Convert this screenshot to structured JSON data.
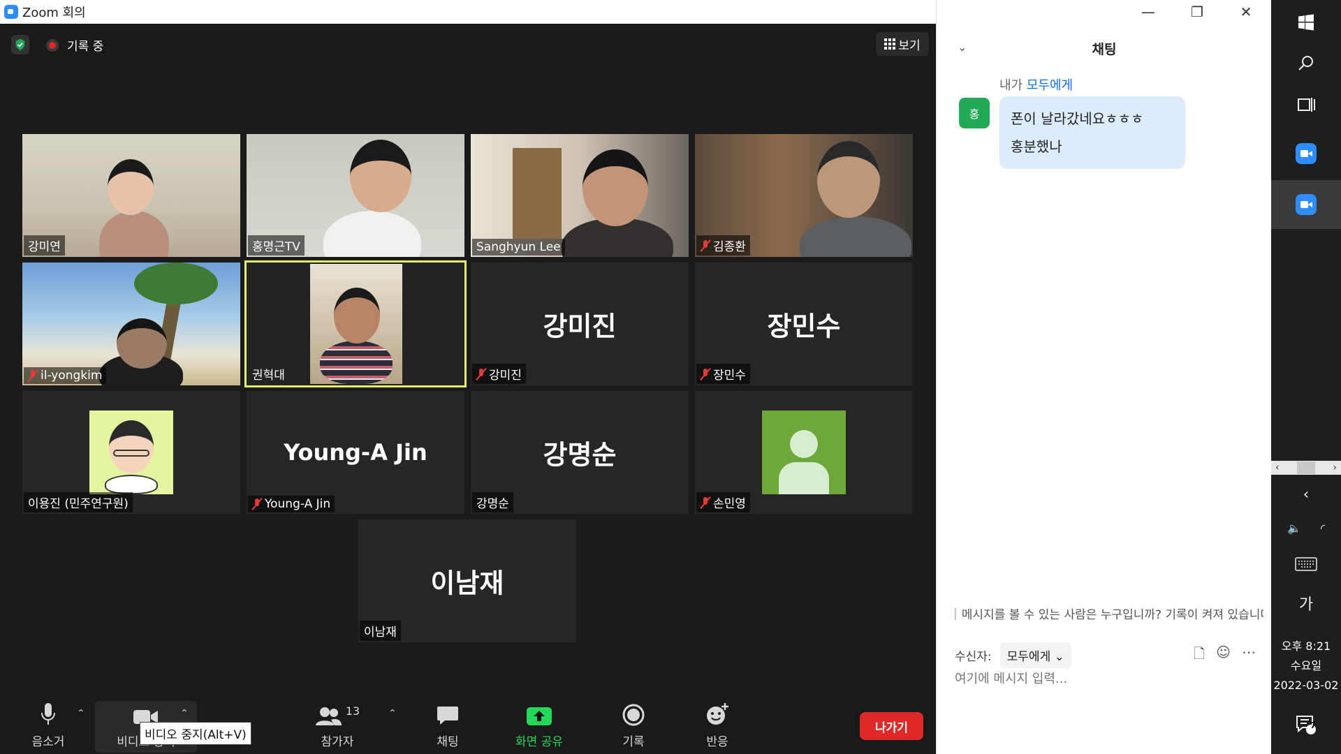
{
  "window": {
    "title": "Zoom 회의",
    "minimize": "—",
    "restore": "❐",
    "close": "✕"
  },
  "meeting": {
    "recording_label": "기록 중",
    "view_label": "보기",
    "participants": [
      {
        "name": "강미연",
        "muted": false,
        "type": "video"
      },
      {
        "name": "홍명근TV",
        "muted": false,
        "type": "video"
      },
      {
        "name": "Sanghyun Lee",
        "muted": false,
        "type": "video"
      },
      {
        "name": "김종환",
        "muted": true,
        "type": "video"
      },
      {
        "name": "il-yongkim",
        "muted": true,
        "type": "video"
      },
      {
        "name": "권혁대",
        "muted": false,
        "type": "video",
        "active": true
      },
      {
        "name": "강미진",
        "muted": true,
        "type": "name",
        "display": "강미진"
      },
      {
        "name": "장민수",
        "muted": true,
        "type": "name",
        "display": "장민수"
      },
      {
        "name": "이용진 (민주연구원)",
        "muted": false,
        "type": "avatar"
      },
      {
        "name": "Young-A Jin",
        "muted": true,
        "type": "name",
        "display": "Young-A Jin"
      },
      {
        "name": "강명순",
        "muted": false,
        "type": "name",
        "display": "강명순"
      },
      {
        "name": "손민영",
        "muted": true,
        "type": "avatar"
      },
      {
        "name": "이남재",
        "muted": false,
        "type": "name",
        "display": "이남재"
      }
    ]
  },
  "toolbar": {
    "mute": "음소거",
    "video": "비디오 중지",
    "video_tooltip": "비디오 중지(Alt+V)",
    "participants": "참가자",
    "participants_count": "13",
    "chat": "채팅",
    "share": "화면 공유",
    "record": "기록",
    "reactions": "반응",
    "leave": "나가기"
  },
  "chat": {
    "title": "채팅",
    "sender_prefix": "내가",
    "recipient": "모두에게",
    "avatar_initial": "홍",
    "message_line1": "폰이 날라갔네요ㅎㅎㅎ",
    "message_line2": "홍분했나",
    "info": "메시지를 볼 수 있는 사람은 누구입니까? 기록이 켜져 있습니다",
    "to_label": "수신자:",
    "to_value": "모두에게",
    "input_placeholder": "여기에 메시지 입력..."
  },
  "taskbar": {
    "ime": "가",
    "time": "오후 8:21",
    "day": "수요일",
    "date": "2022-03-02",
    "notifications": "7"
  },
  "colors": {
    "accent": "#2D8CFF",
    "leave": "#E02828",
    "share": "#23D959",
    "active_border": "#E8F070"
  }
}
